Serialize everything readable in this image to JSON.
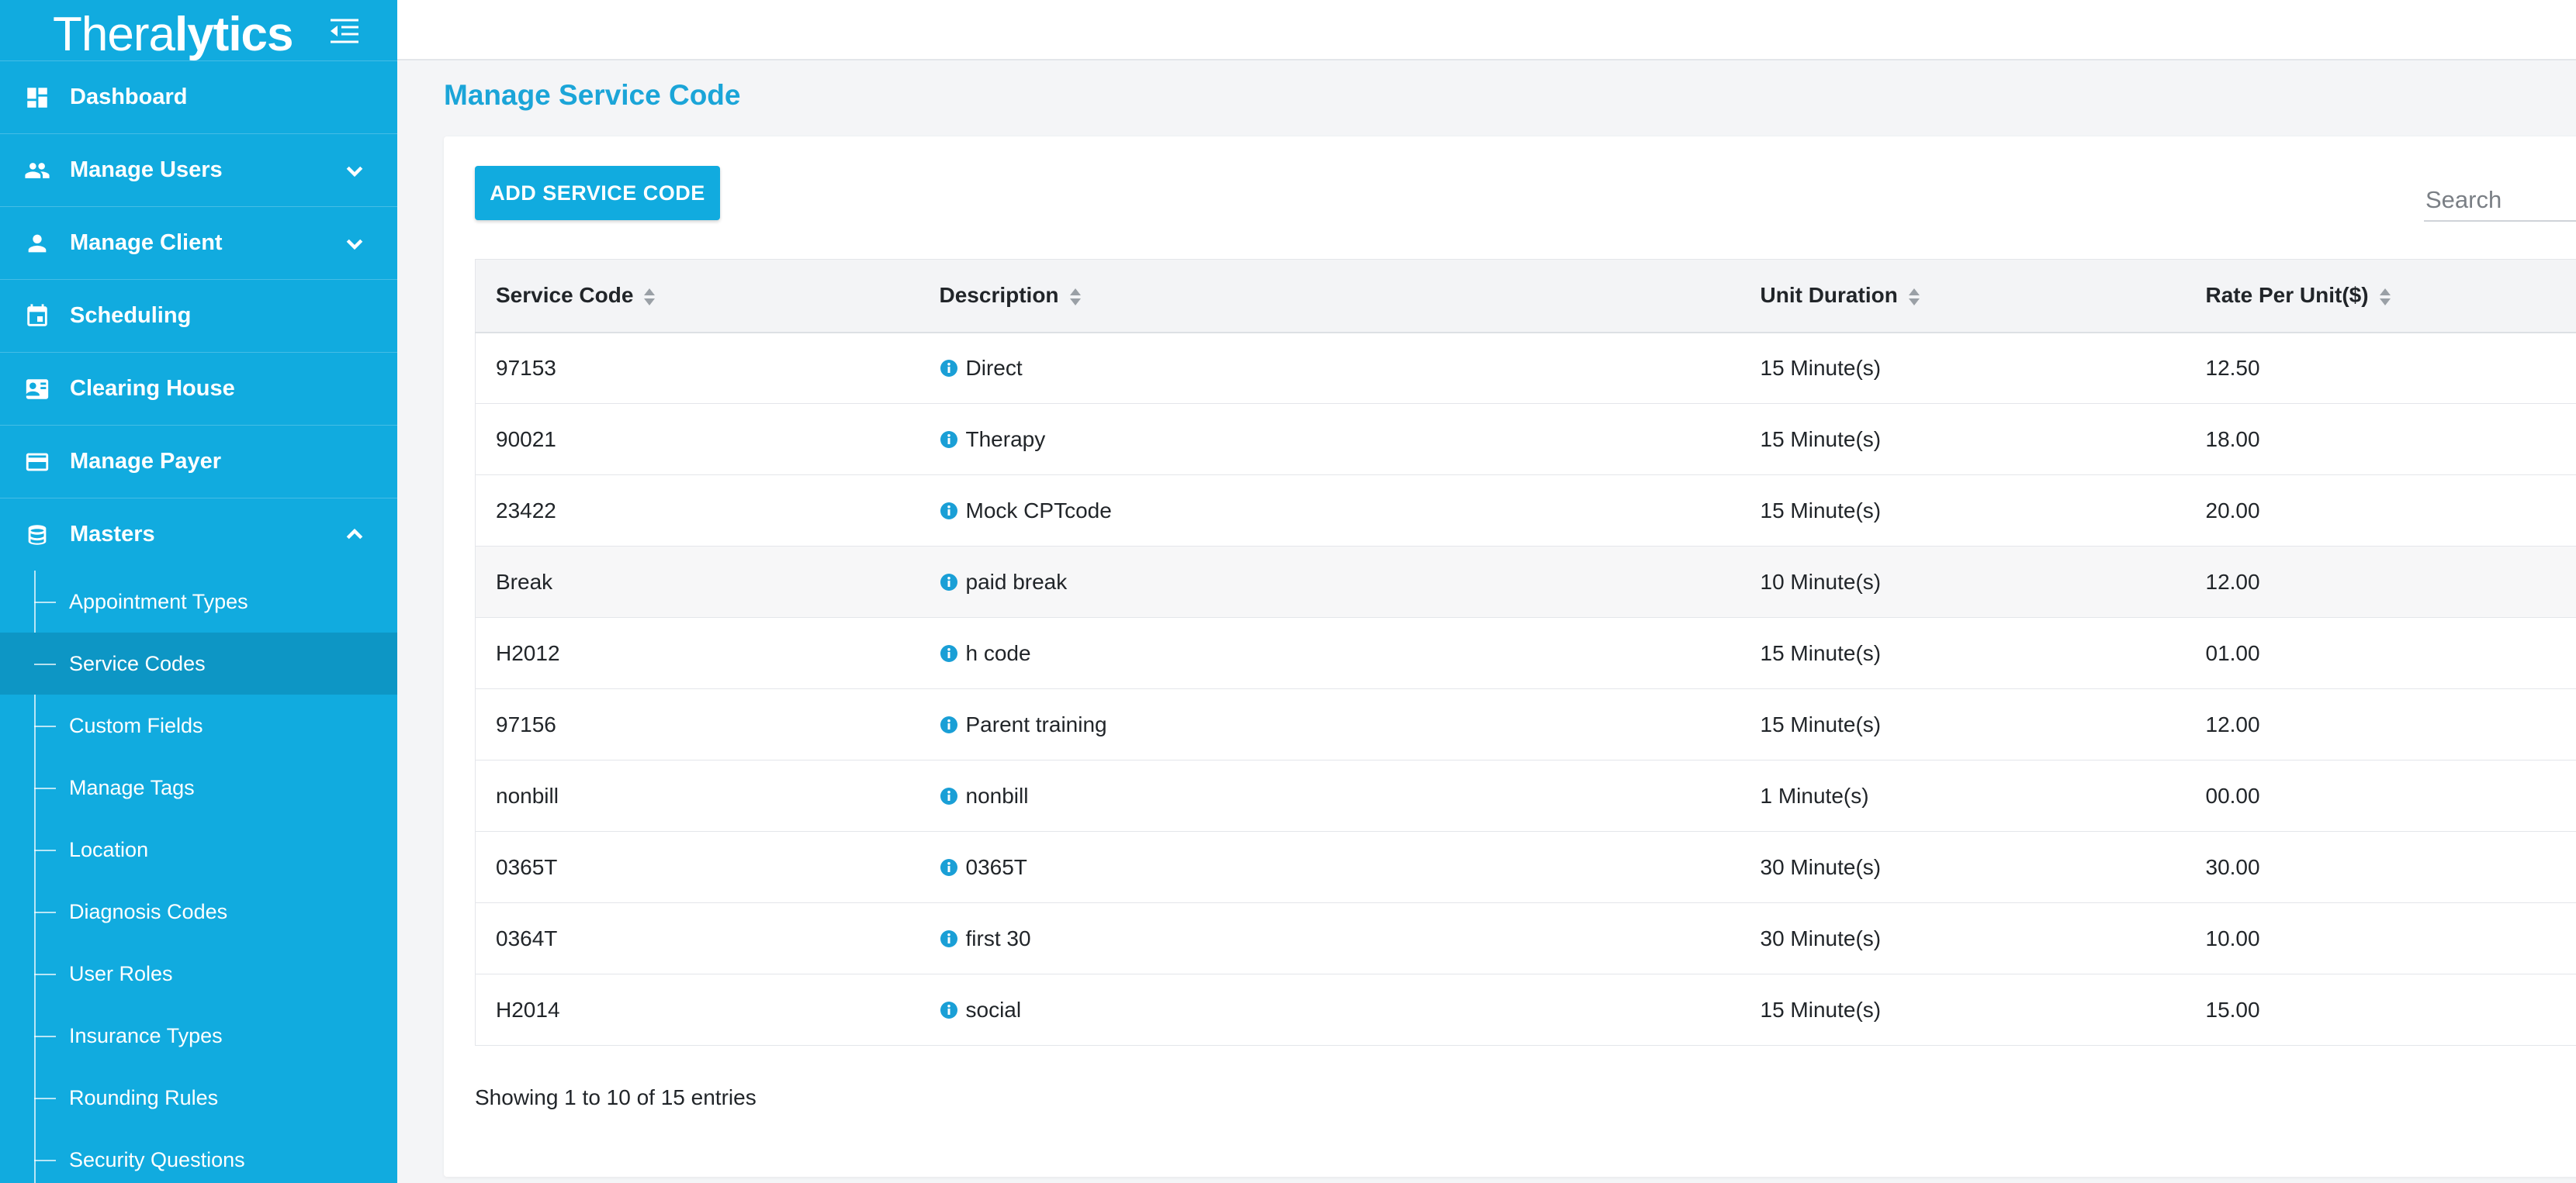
{
  "brand": {
    "logo_light": "Thera",
    "logo_bold": "lytics"
  },
  "sidebar": {
    "items": [
      {
        "label": "Dashboard",
        "icon": "dashboard-icon"
      },
      {
        "label": "Manage Users",
        "icon": "users-icon"
      },
      {
        "label": "Manage Client",
        "icon": "person-icon"
      },
      {
        "label": "Scheduling",
        "icon": "calendar-icon"
      },
      {
        "label": "Clearing House",
        "icon": "id-card-icon"
      },
      {
        "label": "Manage Payer",
        "icon": "credit-card-icon"
      },
      {
        "label": "Masters",
        "icon": "database-icon"
      }
    ],
    "masters_subitems": [
      {
        "label": "Appointment Types"
      },
      {
        "label": "Service Codes"
      },
      {
        "label": "Custom Fields"
      },
      {
        "label": "Manage Tags"
      },
      {
        "label": "Location"
      },
      {
        "label": "Diagnosis Codes"
      },
      {
        "label": "User Roles"
      },
      {
        "label": "Insurance Types"
      },
      {
        "label": "Rounding Rules"
      },
      {
        "label": "Security Questions"
      }
    ],
    "active_subitem": "Service Codes"
  },
  "main": {
    "page_title": "Manage Service Code",
    "add_button_label": "ADD SERVICE CODE",
    "search_placeholder": "Search",
    "table": {
      "columns": [
        "Service Code",
        "Description",
        "Unit Duration",
        "Rate Per Unit($)"
      ],
      "rows": [
        [
          "97153",
          "Direct",
          "15 Minute(s)",
          "12.50"
        ],
        [
          "90021",
          "Therapy",
          "15 Minute(s)",
          "18.00"
        ],
        [
          "23422",
          "Mock CPTcode",
          "15 Minute(s)",
          "20.00"
        ],
        [
          "Break",
          "paid break",
          "10 Minute(s)",
          "12.00"
        ],
        [
          "H2012",
          "h code",
          "15 Minute(s)",
          "01.00"
        ],
        [
          "97156",
          "Parent training",
          "15 Minute(s)",
          "12.00"
        ],
        [
          "nonbill",
          "nonbill",
          "1 Minute(s)",
          "00.00"
        ],
        [
          "0365T",
          "0365T",
          "30 Minute(s)",
          "30.00"
        ],
        [
          "0364T",
          "first 30",
          "30 Minute(s)",
          "10.00"
        ],
        [
          "H2014",
          "social",
          "15 Minute(s)",
          "15.00"
        ]
      ]
    },
    "showing_text": "Showing 1 to 10 of 15 entries"
  },
  "colors": {
    "brand_blue": "#11abdf",
    "active_sub": "#0d96c5",
    "title_blue": "#1ba5d8"
  }
}
